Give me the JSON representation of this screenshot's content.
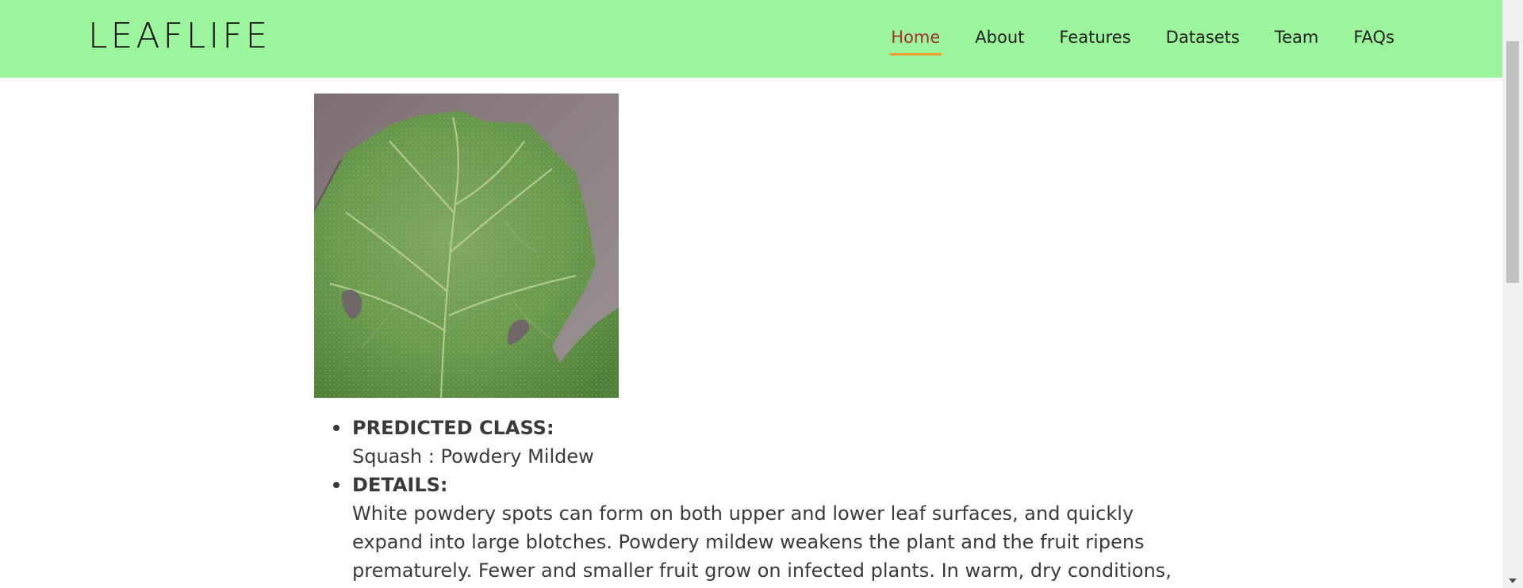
{
  "brand": {
    "name": "LEAFLIFE"
  },
  "nav": {
    "items": [
      {
        "label": "Home",
        "active": true
      },
      {
        "label": "About",
        "active": false
      },
      {
        "label": "Features",
        "active": false
      },
      {
        "label": "Datasets",
        "active": false
      },
      {
        "label": "Team",
        "active": false
      },
      {
        "label": "FAQs",
        "active": false
      }
    ]
  },
  "result": {
    "image_icon": "leaf-photo",
    "predicted_label": "PREDICTED CLASS:",
    "predicted_value": "Squash : Powdery Mildew",
    "details_label": "DETAILS:",
    "details_value": "White powdery spots can form on both upper and lower leaf surfaces, and quickly expand into large blotches. Powdery mildew weakens the plant and the fruit ripens prematurely. Fewer and smaller fruit grow on infected plants. In warm, dry conditions, new spores form and easily"
  },
  "colors": {
    "navbar_bg": "#9cf59c",
    "active_link": "#a0342a",
    "active_underline": "#f0a030",
    "text": "#3a3a3a"
  }
}
